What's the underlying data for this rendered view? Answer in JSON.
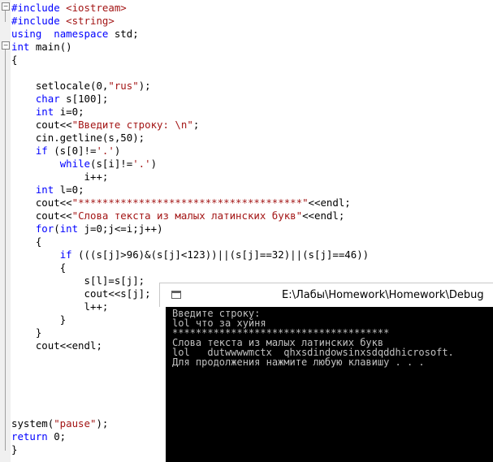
{
  "editor": {
    "lines": [
      {
        "indent": "",
        "parts": [
          [
            "pp",
            "#include "
          ],
          [
            "inc",
            "<iostream>"
          ]
        ]
      },
      {
        "indent": "",
        "parts": [
          [
            "pp",
            "#include "
          ],
          [
            "inc",
            "<string>"
          ]
        ]
      },
      {
        "indent": "",
        "parts": [
          [
            "kw",
            "using"
          ],
          [
            "",
            "  "
          ],
          [
            "kw",
            "namespace"
          ],
          [
            "",
            " std;"
          ]
        ]
      },
      {
        "indent": "",
        "parts": [
          [
            "kw",
            "int"
          ],
          [
            "",
            " main()"
          ]
        ]
      },
      {
        "indent": "",
        "parts": [
          [
            "",
            "{"
          ]
        ]
      },
      {
        "indent": "",
        "parts": [
          [
            "",
            ""
          ]
        ]
      },
      {
        "indent": "    ",
        "parts": [
          [
            "",
            "setlocale(0,"
          ],
          [
            "str",
            "\"rus\""
          ],
          [
            "",
            ");"
          ]
        ]
      },
      {
        "indent": "    ",
        "parts": [
          [
            "kw",
            "char"
          ],
          [
            "",
            " s[100];"
          ]
        ]
      },
      {
        "indent": "    ",
        "parts": [
          [
            "kw",
            "int"
          ],
          [
            "",
            " i=0;"
          ]
        ]
      },
      {
        "indent": "    ",
        "parts": [
          [
            "",
            "cout<<"
          ],
          [
            "str",
            "\"Введите строку: \\n\""
          ],
          [
            "",
            ";"
          ]
        ]
      },
      {
        "indent": "    ",
        "parts": [
          [
            "",
            "cin.getline(s,50);"
          ]
        ]
      },
      {
        "indent": "    ",
        "parts": [
          [
            "kw",
            "if"
          ],
          [
            "",
            " (s[0]!="
          ],
          [
            "str",
            "'.'"
          ],
          [
            "",
            ")"
          ]
        ]
      },
      {
        "indent": "        ",
        "parts": [
          [
            "kw",
            "while"
          ],
          [
            "",
            "(s[i]!="
          ],
          [
            "str",
            "'.'"
          ],
          [
            "",
            ")"
          ]
        ]
      },
      {
        "indent": "            ",
        "parts": [
          [
            "",
            "i++;"
          ]
        ]
      },
      {
        "indent": "    ",
        "parts": [
          [
            "kw",
            "int"
          ],
          [
            "",
            " l=0;"
          ]
        ]
      },
      {
        "indent": "    ",
        "parts": [
          [
            "",
            "cout<<"
          ],
          [
            "str",
            "\"*************************************\""
          ],
          [
            "",
            "<<endl;"
          ]
        ]
      },
      {
        "indent": "    ",
        "parts": [
          [
            "",
            "cout<<"
          ],
          [
            "str",
            "\"Слова текста из малых латинских букв\""
          ],
          [
            "",
            "<<endl;"
          ]
        ]
      },
      {
        "indent": "    ",
        "parts": [
          [
            "kw",
            "for"
          ],
          [
            "",
            "("
          ],
          [
            "kw",
            "int"
          ],
          [
            "",
            " j=0;j<=i;j++)"
          ]
        ]
      },
      {
        "indent": "    ",
        "parts": [
          [
            "",
            "{"
          ]
        ]
      },
      {
        "indent": "        ",
        "parts": [
          [
            "kw",
            "if"
          ],
          [
            "",
            " (((s[j]>96)&(s[j]<123))||(s[j]==32)||(s[j]==46))"
          ]
        ]
      },
      {
        "indent": "        ",
        "parts": [
          [
            "",
            "{"
          ]
        ]
      },
      {
        "indent": "            ",
        "parts": [
          [
            "",
            "s[l]=s[j];"
          ]
        ]
      },
      {
        "indent": "            ",
        "parts": [
          [
            "",
            "cout<<s[j];"
          ]
        ]
      },
      {
        "indent": "            ",
        "parts": [
          [
            "",
            "l++;"
          ]
        ]
      },
      {
        "indent": "        ",
        "parts": [
          [
            "",
            "}"
          ]
        ]
      },
      {
        "indent": "    ",
        "parts": [
          [
            "",
            "}"
          ]
        ]
      },
      {
        "indent": "    ",
        "parts": [
          [
            "",
            "cout<<endl;"
          ]
        ]
      },
      {
        "indent": "",
        "parts": [
          [
            "",
            ""
          ]
        ]
      },
      {
        "indent": "",
        "parts": [
          [
            "",
            ""
          ]
        ]
      },
      {
        "indent": "",
        "parts": [
          [
            "",
            ""
          ]
        ]
      },
      {
        "indent": "",
        "parts": [
          [
            "",
            ""
          ]
        ]
      },
      {
        "indent": "",
        "parts": [
          [
            "",
            ""
          ]
        ]
      },
      {
        "indent": "",
        "parts": [
          [
            "",
            "system("
          ],
          [
            "str",
            "\"pause\""
          ],
          [
            "",
            ");"
          ]
        ]
      },
      {
        "indent": "",
        "parts": [
          [
            "kw",
            "return"
          ],
          [
            "",
            " 0;"
          ]
        ]
      },
      {
        "indent": "",
        "parts": [
          [
            "",
            "}"
          ]
        ]
      }
    ]
  },
  "console": {
    "title": "E:\\Лабы\\Homework\\Homework\\Debug",
    "output": [
      "Введите строку:",
      "lol что за хуйня",
      "*************************************",
      "Слова текста из малых латинских букв",
      "lol   dutwwwwmctx  qhxsdindowsinxsdqddhicrosoft.",
      "Для продолжения нажмите любую клавишу . . ."
    ]
  }
}
